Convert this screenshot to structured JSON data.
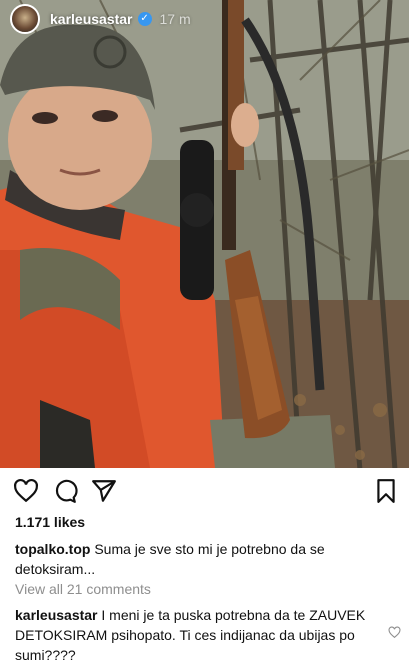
{
  "post": {
    "username": "karleusastar",
    "time": "17 m",
    "verified_icon": "verified-badge-icon",
    "likes": "1.171 likes"
  },
  "actions": {
    "like_icon": "heart-outline-icon",
    "comment_icon": "comment-bubble-icon",
    "share_icon": "paper-plane-icon",
    "save_icon": "bookmark-icon"
  },
  "caption": {
    "username": "topalko.top",
    "text": "Suma je sve sto mi je potrebno da se detoksiram..."
  },
  "view_all_comments": "View all 21 comments",
  "comment": {
    "username": "karleusastar",
    "text": "I meni je ta puska potrebna da te ZAUVEK DETOKSIRAM psihopato. Ti ces indijanac da ubijas po sumi????"
  },
  "colors": {
    "verified": "#3897f0",
    "secondary_text": "#8e8e8e",
    "jacket": "#e0572e"
  }
}
